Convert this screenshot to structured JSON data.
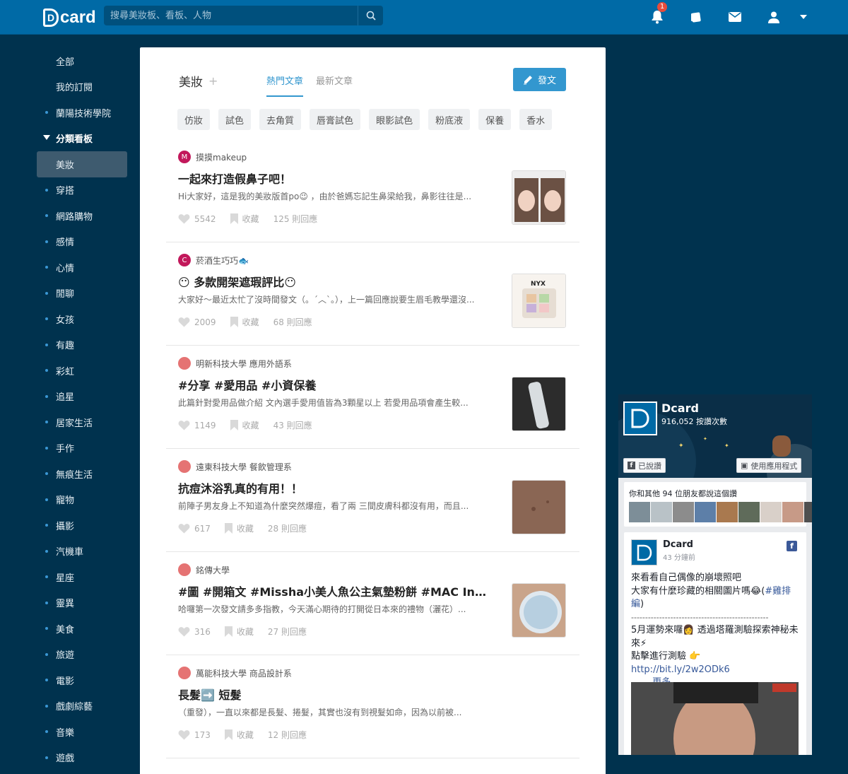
{
  "app": {
    "logo_text": "card"
  },
  "search": {
    "placeholder": "搜尋美妝板、看板、人物"
  },
  "topbar": {
    "notification_count": "1"
  },
  "sidebar": {
    "items": [
      {
        "label": "全部",
        "dot": false
      },
      {
        "label": "我的訂閱",
        "dot": false
      },
      {
        "label": "蘭陽技術學院",
        "dot": true
      }
    ],
    "section_header": "分類看板",
    "forums": [
      "美妝",
      "穿搭",
      "網路購物",
      "感情",
      "心情",
      "閒聊",
      "女孩",
      "有趣",
      "彩虹",
      "追星",
      "居家生活",
      "手作",
      "無痕生活",
      "寵物",
      "攝影",
      "汽機車",
      "星座",
      "靈異",
      "美食",
      "旅遊",
      "電影",
      "戲劇綜藝",
      "音樂",
      "遊戲"
    ],
    "active_forum": "美妝"
  },
  "forum": {
    "name": "美妝",
    "plus": "+",
    "tabs": [
      "熱門文章",
      "最新文章"
    ],
    "post_button": "發文",
    "chips": [
      "仿妝",
      "試色",
      "去角質",
      "唇膏試色",
      "眼影試色",
      "粉底液",
      "保養",
      "香水"
    ]
  },
  "posts": [
    {
      "avatar": "M",
      "avatar_color": "#c2185b",
      "author": "摸摸makeup",
      "title": "一起來打造假鼻子吧！",
      "excerpt": "Hi大家好，這是我的美妝版首po😉 ，由於爸媽忘記生鼻梁給我，鼻影往往是...",
      "likes": "5542",
      "save_label": "收藏",
      "comments": "125 則回應"
    },
    {
      "avatar": "C",
      "avatar_color": "#c2185b",
      "author": "菸酒生巧巧🐟",
      "title": "😶 多款開架遮瑕評比😶",
      "excerpt": "大家好～最近太忙了沒時間發文（。´︿`。），上一篇回應說要生眉毛教學還沒...",
      "likes": "2009",
      "save_label": "收藏",
      "comments": "68 則回應"
    },
    {
      "avatar": "",
      "avatar_color": "#e57373",
      "author": "明新科技大學 應用外語系",
      "title": "#分享 #愛用品 #小資保養",
      "excerpt": "此篇針對愛用品做介紹 文內選手愛用值皆為3顆星以上 若愛用品項會產生較...",
      "likes": "1149",
      "save_label": "收藏",
      "comments": "43 則回應"
    },
    {
      "avatar": "",
      "avatar_color": "#e57373",
      "author": "遠東科技大學 餐飲管理系",
      "title": "抗痘沐浴乳真的有用！！",
      "excerpt": "前陣子男友身上不知道為什麼突然爆痘，看了兩 三間皮膚科都沒有用，而且...",
      "likes": "617",
      "save_label": "收藏",
      "comments": "28 則回應"
    },
    {
      "avatar": "",
      "avatar_color": "#e57373",
      "author": "銘傳大學",
      "title": "#圖 #開箱文 #Missha小美人魚公主氣墊粉餅 #MAC In retr...",
      "excerpt": "哈囉第一次發文請多多指教，今天滿心期待的打開從日本來的禮物（灑花）...",
      "likes": "316",
      "save_label": "收藏",
      "comments": "27 則回應"
    },
    {
      "avatar": "",
      "avatar_color": "#e57373",
      "author": "萬能科技大學 商品設計系",
      "title": "長髮➡️ 短髮",
      "excerpt": "（重發），一直以來都是長髮、捲髮，其實也沒有到視髮如命，因為以前被...",
      "likes": "173",
      "save_label": "收藏",
      "comments": "12 則回應"
    }
  ],
  "facebook": {
    "page_name": "Dcard",
    "likes": "916,052 按讚次數",
    "liked_label": "已說讚",
    "app_label": "使用應用程式",
    "friends_text": "你和其他 94 位朋友都說這個讚",
    "post_author": "Dcard",
    "post_time": "43 分鐘前",
    "post_line1": "來看看自己偶像的崩壞照吧",
    "post_line2": "大家有什麼珍藏的相關圖片嗎😂(",
    "post_link1": "#雞排編",
    "post_line2_end": ")",
    "post_separator": "-------------------------------------------------",
    "post_line3": "5月運勢來囉👩 透過塔羅測驗探索神秘未來⚡",
    "post_line4": "點擊進行測驗 👉",
    "post_link2": "http://bit.ly/2w2ODk6",
    "post_more_prefix": "……",
    "post_more": "更多"
  },
  "colors": {
    "topbar": "#006aa6",
    "background": "#00324e",
    "accent": "#3397cf"
  }
}
